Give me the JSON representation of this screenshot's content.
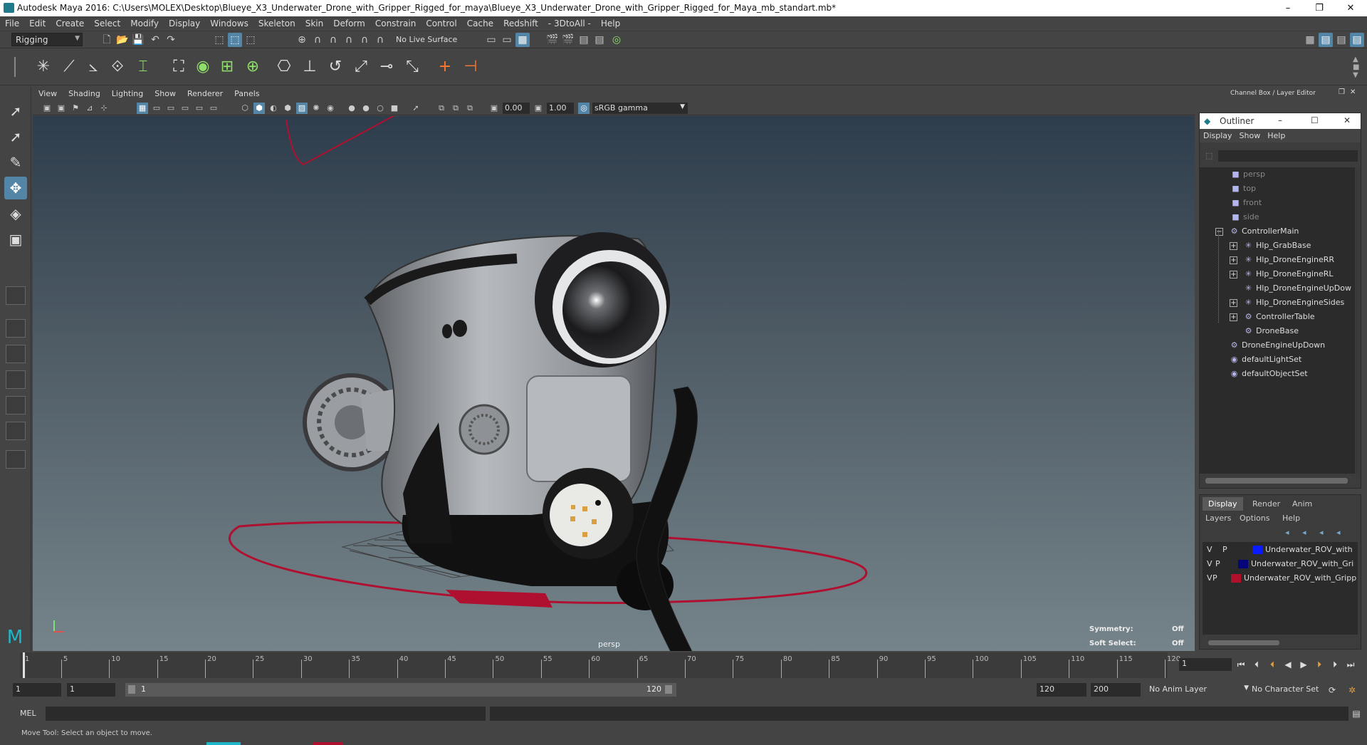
{
  "window": {
    "title": "Autodesk Maya 2016: C:\\Users\\MOLEX\\Desktop\\Blueye_X3_Underwater_Drone_with_Gripper_Rigged_for_maya\\Blueye_X3_Underwater_Drone_with_Gripper_Rigged_for_Maya_mb_standart.mb*",
    "minimize": "–",
    "maximize": "❐",
    "close": "✕"
  },
  "menubar": [
    "File",
    "Edit",
    "Create",
    "Select",
    "Modify",
    "Display",
    "Windows",
    "Skeleton",
    "Skin",
    "Deform",
    "Constrain",
    "Control",
    "Cache",
    "Redshift",
    "- 3DtoAll -",
    "Help"
  ],
  "statusline": {
    "menuset": "Rigging",
    "live_surface": "No Live Surface"
  },
  "viewport_menu": [
    "View",
    "Shading",
    "Lighting",
    "Show",
    "Renderer",
    "Panels"
  ],
  "viewport_toolbar": {
    "exposure": "0.00",
    "gamma": "1.00",
    "colorspace": "sRGB gamma"
  },
  "viewport": {
    "camera": "persp",
    "symmetry_label": "Symmetry:",
    "symmetry_value": "Off",
    "softselect_label": "Soft Select:",
    "softselect_value": "Off"
  },
  "channel_box_header": "Channel Box / Layer Editor",
  "outliner": {
    "title": "Outliner",
    "menu": [
      "Display",
      "Show",
      "Help"
    ],
    "items": [
      {
        "label": "persp",
        "icon": "camera-icon"
      },
      {
        "label": "top",
        "icon": "camera-icon"
      },
      {
        "label": "front",
        "icon": "camera-icon"
      },
      {
        "label": "side",
        "icon": "camera-icon"
      },
      {
        "label": "ControllerMain",
        "icon": "transform-icon"
      },
      {
        "label": "Hlp_GrabBase",
        "icon": "locator-icon"
      },
      {
        "label": "Hlp_DroneEngineRR",
        "icon": "locator-icon"
      },
      {
        "label": "Hlp_DroneEngineRL",
        "icon": "locator-icon"
      },
      {
        "label": "Hlp_DroneEngineUpDow",
        "icon": "locator-icon"
      },
      {
        "label": "Hlp_DroneEngineSides",
        "icon": "locator-icon"
      },
      {
        "label": "ControllerTable",
        "icon": "transform-icon"
      },
      {
        "label": "DroneBase",
        "icon": "transform-icon"
      },
      {
        "label": "DroneEngineUpDown",
        "icon": "transform-icon"
      },
      {
        "label": "defaultLightSet",
        "icon": "set-icon"
      },
      {
        "label": "defaultObjectSet",
        "icon": "set-icon"
      }
    ]
  },
  "layer_editor": {
    "tabs": [
      "Display",
      "Render",
      "Anim"
    ],
    "menu": [
      "Layers",
      "Options",
      "Help"
    ],
    "layers": [
      {
        "v": "V",
        "p": "P",
        "name": "Underwater_ROV_with",
        "color": "#0a1cff"
      },
      {
        "v": "V",
        "p": "P",
        "name": "Underwater_ROV_with_Gri",
        "color": "#06067a"
      },
      {
        "v": "V",
        "p": "P",
        "name": "Underwater_ROV_with_Gripp",
        "color": "#b0102a"
      }
    ]
  },
  "timeline": {
    "labels": [
      "1",
      "5",
      "10",
      "15",
      "20",
      "25",
      "30",
      "35",
      "40",
      "45",
      "50",
      "55",
      "60",
      "65",
      "70",
      "75",
      "80",
      "85",
      "90",
      "95",
      "100",
      "105",
      "110",
      "115",
      "120"
    ],
    "current_frame": "1"
  },
  "range": {
    "start": "1",
    "playback_start": "1",
    "slider_start": "1",
    "slider_end": "120",
    "playback_end": "120",
    "end": "200",
    "anim_layer": "No Anim Layer",
    "char_set": "No Character Set"
  },
  "cmdline": {
    "label": "MEL"
  },
  "helpline": "Move Tool: Select an object to move."
}
